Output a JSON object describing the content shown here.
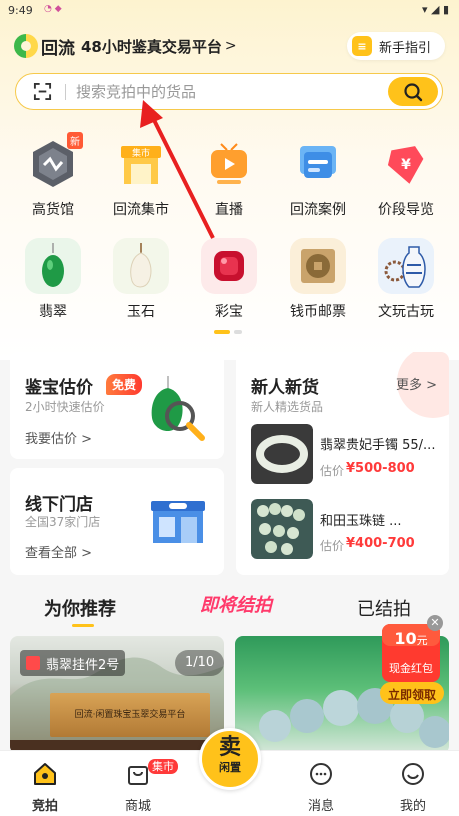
{
  "status": {
    "time": "9:49"
  },
  "header": {
    "logo_text": "回流",
    "tagline": "48小时鉴真交易平台",
    "tagline_arrow": ">",
    "guide_label": "新手指引"
  },
  "search": {
    "placeholder": "搜索竞拍中的货品"
  },
  "categories_row1": [
    {
      "label": "高货馆",
      "badge": "新"
    },
    {
      "label": "回流集市",
      "icon_text": "集市"
    },
    {
      "label": "直播"
    },
    {
      "label": "回流案例"
    },
    {
      "label": "价段导览",
      "icon_text": "¥"
    }
  ],
  "categories_row2": [
    {
      "label": "翡翠"
    },
    {
      "label": "玉石"
    },
    {
      "label": "彩宝"
    },
    {
      "label": "钱币邮票"
    },
    {
      "label": "文玩古玩"
    }
  ],
  "appraisal": {
    "title": "鉴宝估价",
    "badge": "免费",
    "subtitle": "2小时快速估价",
    "link": "我要估价 >"
  },
  "stores": {
    "title": "线下门店",
    "subtitle": "全国37家门店",
    "link": "查看全部 >"
  },
  "newcomer": {
    "title": "新人新货",
    "more": "更多 >",
    "subtitle": "新人精选货品",
    "products": [
      {
        "name": "翡翠贵妃手镯 55/...",
        "price_label": "估价",
        "price": "¥500-800"
      },
      {
        "name": "和田玉珠链 ...",
        "price_label": "估价",
        "price": "¥400-700"
      }
    ]
  },
  "tabs": {
    "recommend": "为你推荐",
    "ending": "即将结拍",
    "ended": "已结拍"
  },
  "feed": {
    "card1_tag": "翡翠挂件2号",
    "card1_counter": "1/10",
    "card1_sign": "回流·闲置珠宝玉翠交易平台"
  },
  "redpack": {
    "amount": "10",
    "unit": "元",
    "label": "现金红包",
    "cta": "立即领取"
  },
  "nav": {
    "auction": "竞拍",
    "market": "商城",
    "market_badge": "集市",
    "sell": "卖",
    "sell_sub": "闲置",
    "messages": "消息",
    "mine": "我的"
  },
  "colors": {
    "accent": "#ffc21a",
    "price": "#ff3a3a",
    "hot_tab": "#ff3a6b"
  }
}
